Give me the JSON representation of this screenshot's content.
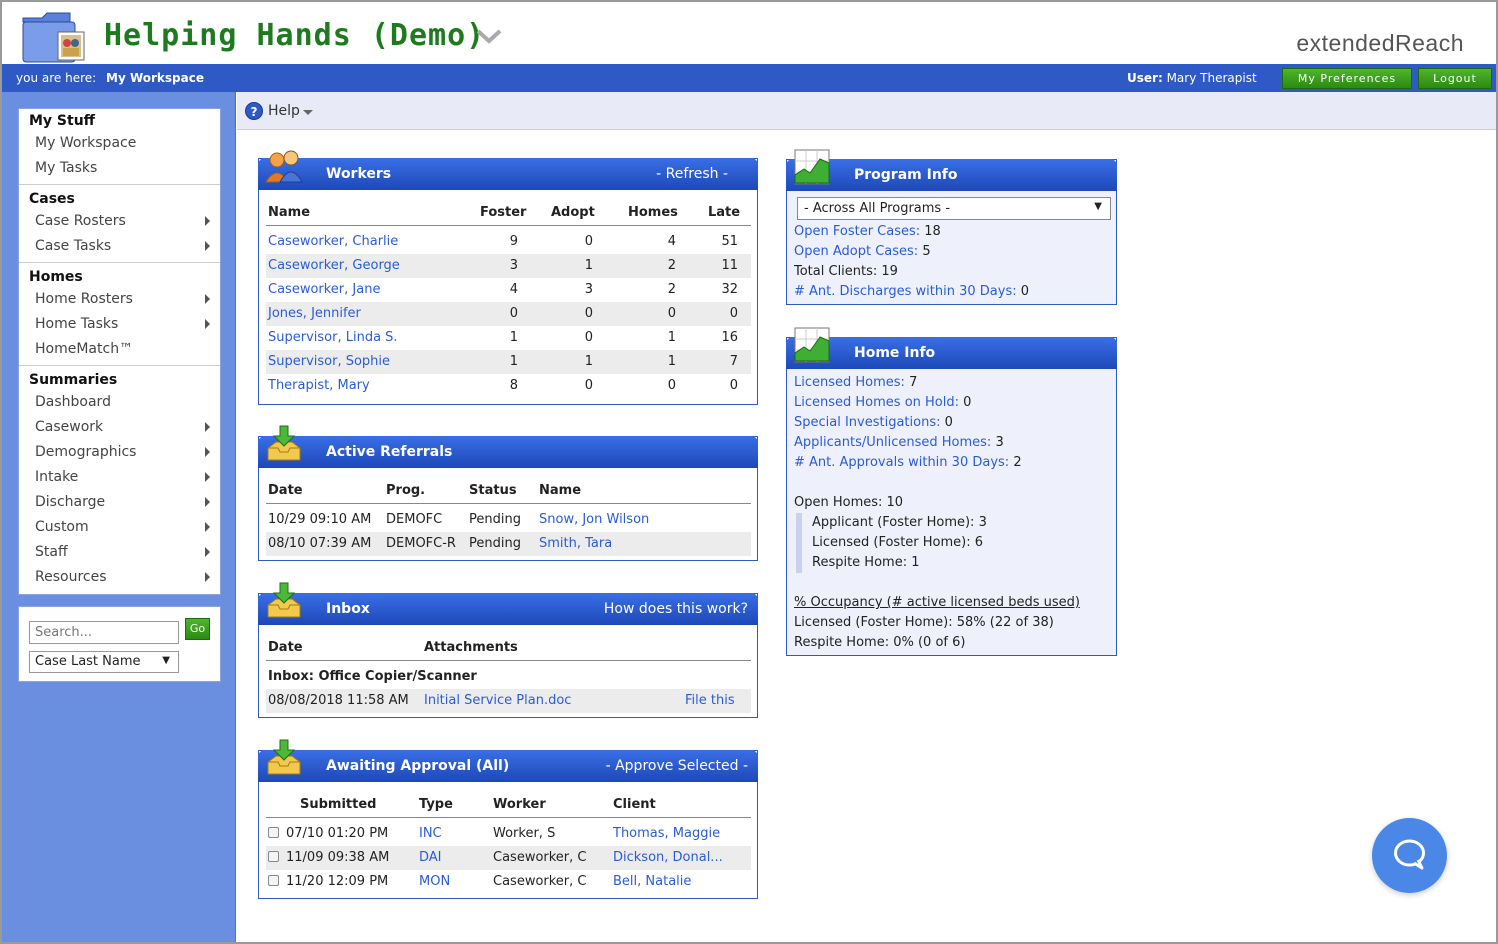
{
  "app": {
    "title": "Helping Hands (Demo)",
    "brand": "extendedReach",
    "breadcrumb_prefix": "you are here:",
    "breadcrumb_current": "My Workspace",
    "user_label": "User:",
    "user_name": "Mary Therapist",
    "preferences_label": "My Preferences",
    "logout_label": "Logout"
  },
  "sidebar": {
    "sections": [
      {
        "title": "My Stuff",
        "items": [
          {
            "label": "My Workspace",
            "arrow": false
          },
          {
            "label": "My Tasks",
            "arrow": false
          }
        ]
      },
      {
        "title": "Cases",
        "items": [
          {
            "label": "Case Rosters",
            "arrow": true
          },
          {
            "label": "Case Tasks",
            "arrow": true
          }
        ]
      },
      {
        "title": "Homes",
        "items": [
          {
            "label": "Home Rosters",
            "arrow": true
          },
          {
            "label": "Home Tasks",
            "arrow": true
          },
          {
            "label": "HomeMatch™",
            "arrow": false
          }
        ]
      },
      {
        "title": "Summaries",
        "items": [
          {
            "label": "Dashboard",
            "arrow": false
          },
          {
            "label": "Casework",
            "arrow": true
          },
          {
            "label": "Demographics",
            "arrow": true
          },
          {
            "label": "Intake",
            "arrow": true
          },
          {
            "label": "Discharge",
            "arrow": true
          },
          {
            "label": "Custom",
            "arrow": true
          },
          {
            "label": "Staff",
            "arrow": true
          },
          {
            "label": "Resources",
            "arrow": true
          }
        ]
      }
    ],
    "search_placeholder": "Search...",
    "go_label": "Go",
    "search_type": "Case Last Name"
  },
  "helpbar": {
    "label": "Help"
  },
  "workers": {
    "title": "Workers",
    "action": "- Refresh -",
    "columns": [
      "Name",
      "Foster",
      "Adopt",
      "Homes",
      "Late"
    ],
    "rows": [
      {
        "name": "Caseworker, Charlie",
        "foster": "9",
        "adopt": "0",
        "homes": "4",
        "late": "51"
      },
      {
        "name": "Caseworker, George",
        "foster": "3",
        "adopt": "1",
        "homes": "2",
        "late": "11"
      },
      {
        "name": "Caseworker, Jane",
        "foster": "4",
        "adopt": "3",
        "homes": "2",
        "late": "32"
      },
      {
        "name": "Jones, Jennifer",
        "foster": "0",
        "adopt": "0",
        "homes": "0",
        "late": "0"
      },
      {
        "name": "Supervisor, Linda S.",
        "foster": "1",
        "adopt": "0",
        "homes": "1",
        "late": "16"
      },
      {
        "name": "Supervisor, Sophie",
        "foster": "1",
        "adopt": "1",
        "homes": "1",
        "late": "7"
      },
      {
        "name": "Therapist, Mary",
        "foster": "8",
        "adopt": "0",
        "homes": "0",
        "late": "0"
      }
    ]
  },
  "referrals": {
    "title": "Active Referrals",
    "columns": [
      "Date",
      "Prog.",
      "Status",
      "Name"
    ],
    "rows": [
      {
        "date": "10/29 09:10 AM",
        "prog": "DEMOFC",
        "status": "Pending",
        "name": "Snow, Jon Wilson"
      },
      {
        "date": "08/10 07:39 AM",
        "prog": "DEMOFC-R",
        "status": "Pending",
        "name": "Smith, Tara"
      }
    ]
  },
  "inbox": {
    "title": "Inbox",
    "action": "How does this work?",
    "columns": [
      "Date",
      "Attachments"
    ],
    "group": "Inbox: Office Copier/Scanner",
    "rows": [
      {
        "date": "08/08/2018 11:58 AM",
        "file": "Initial Service Plan.doc",
        "action": "File this"
      }
    ]
  },
  "approval": {
    "title": "Awaiting Approval (All)",
    "action": "- Approve Selected -",
    "columns": [
      "Submitted",
      "Type",
      "Worker",
      "Client"
    ],
    "rows": [
      {
        "submitted": "07/10 01:20 PM",
        "type": "INC",
        "worker": "Worker, S",
        "client": "Thomas, Maggie"
      },
      {
        "submitted": "11/09 09:38 AM",
        "type": "DAI",
        "worker": "Caseworker, C",
        "client": "Dickson, Donal..."
      },
      {
        "submitted": "11/20 12:09 PM",
        "type": "MON",
        "worker": "Caseworker, C",
        "client": "Bell, Natalie"
      }
    ]
  },
  "program": {
    "title": "Program Info",
    "select": "- Across All Programs -",
    "open_foster_label": "Open Foster Cases:",
    "open_foster_value": "18",
    "open_adopt_label": "Open Adopt Cases:",
    "open_adopt_value": "5",
    "total_clients": "Total Clients: 19",
    "discharges_label": "# Ant. Discharges within 30 Days:",
    "discharges_value": "0"
  },
  "homeinfo": {
    "title": "Home Info",
    "licensed_label": "Licensed Homes:",
    "licensed_value": "7",
    "onhold_label": "Licensed Homes on Hold:",
    "onhold_value": "0",
    "special_label": "Special Investigations:",
    "special_value": "0",
    "applicants_label": "Applicants/Unlicensed Homes:",
    "applicants_value": "3",
    "approvals_label": "# Ant. Approvals within 30 Days:",
    "approvals_value": "2",
    "open_homes": "Open Homes: 10",
    "breakdown": [
      "Applicant (Foster Home): 3",
      "Licensed (Foster Home): 6",
      "Respite Home: 1"
    ],
    "occupancy_link": "% Occupancy (# active licensed beds used)",
    "occ_licensed": "Licensed (Foster Home): 58% (22 of 38)",
    "occ_respite": "Respite Home: 0% (0 of 6)"
  }
}
